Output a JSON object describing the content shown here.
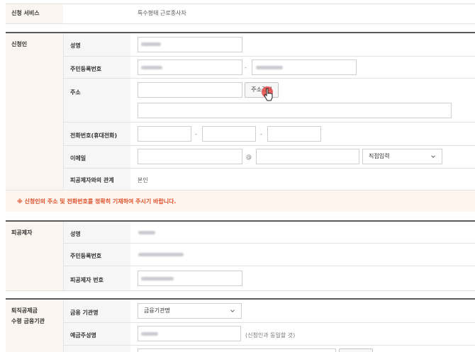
{
  "service": {
    "label": "신청 서비스",
    "value": "특수형태 근로종사자"
  },
  "applicant": {
    "section_title": "신청인",
    "name_label": "성명",
    "rrn_label": "주민등록번호",
    "address_label": "주소",
    "address_search_button": "주소검색",
    "phone_label": "전화번호(휴대전화)",
    "email_label": "이메일",
    "email_at": "@",
    "email_domain_select": "직접입력",
    "relation_label": "피공제자와의 관계",
    "relation_value": "본인",
    "dash": "-"
  },
  "notice": "※ 신청인의 주소 및 전화번호를 정확히 기재하여 주시기 바랍니다.",
  "insured": {
    "section_title": "피공제자",
    "name_label": "성명",
    "rrn_label": "주민등록번호",
    "member_no_label": "피공제자 번호"
  },
  "bank": {
    "section_title_line1": "퇴직공제금",
    "section_title_line2": "수령 금융기관",
    "institution_label": "금융 기관명",
    "institution_select": "금융기관명",
    "depositor_label": "예금주성명",
    "depositor_note": "(신청인과 동일할 것)"
  },
  "icons": {
    "chevron": "chevron-down-icon",
    "cursor": "hand-cursor-icon"
  },
  "colors": {
    "notice_text": "#e0502a",
    "section_bg": "#fbf5ef",
    "label_bg": "#f6f6f6"
  }
}
